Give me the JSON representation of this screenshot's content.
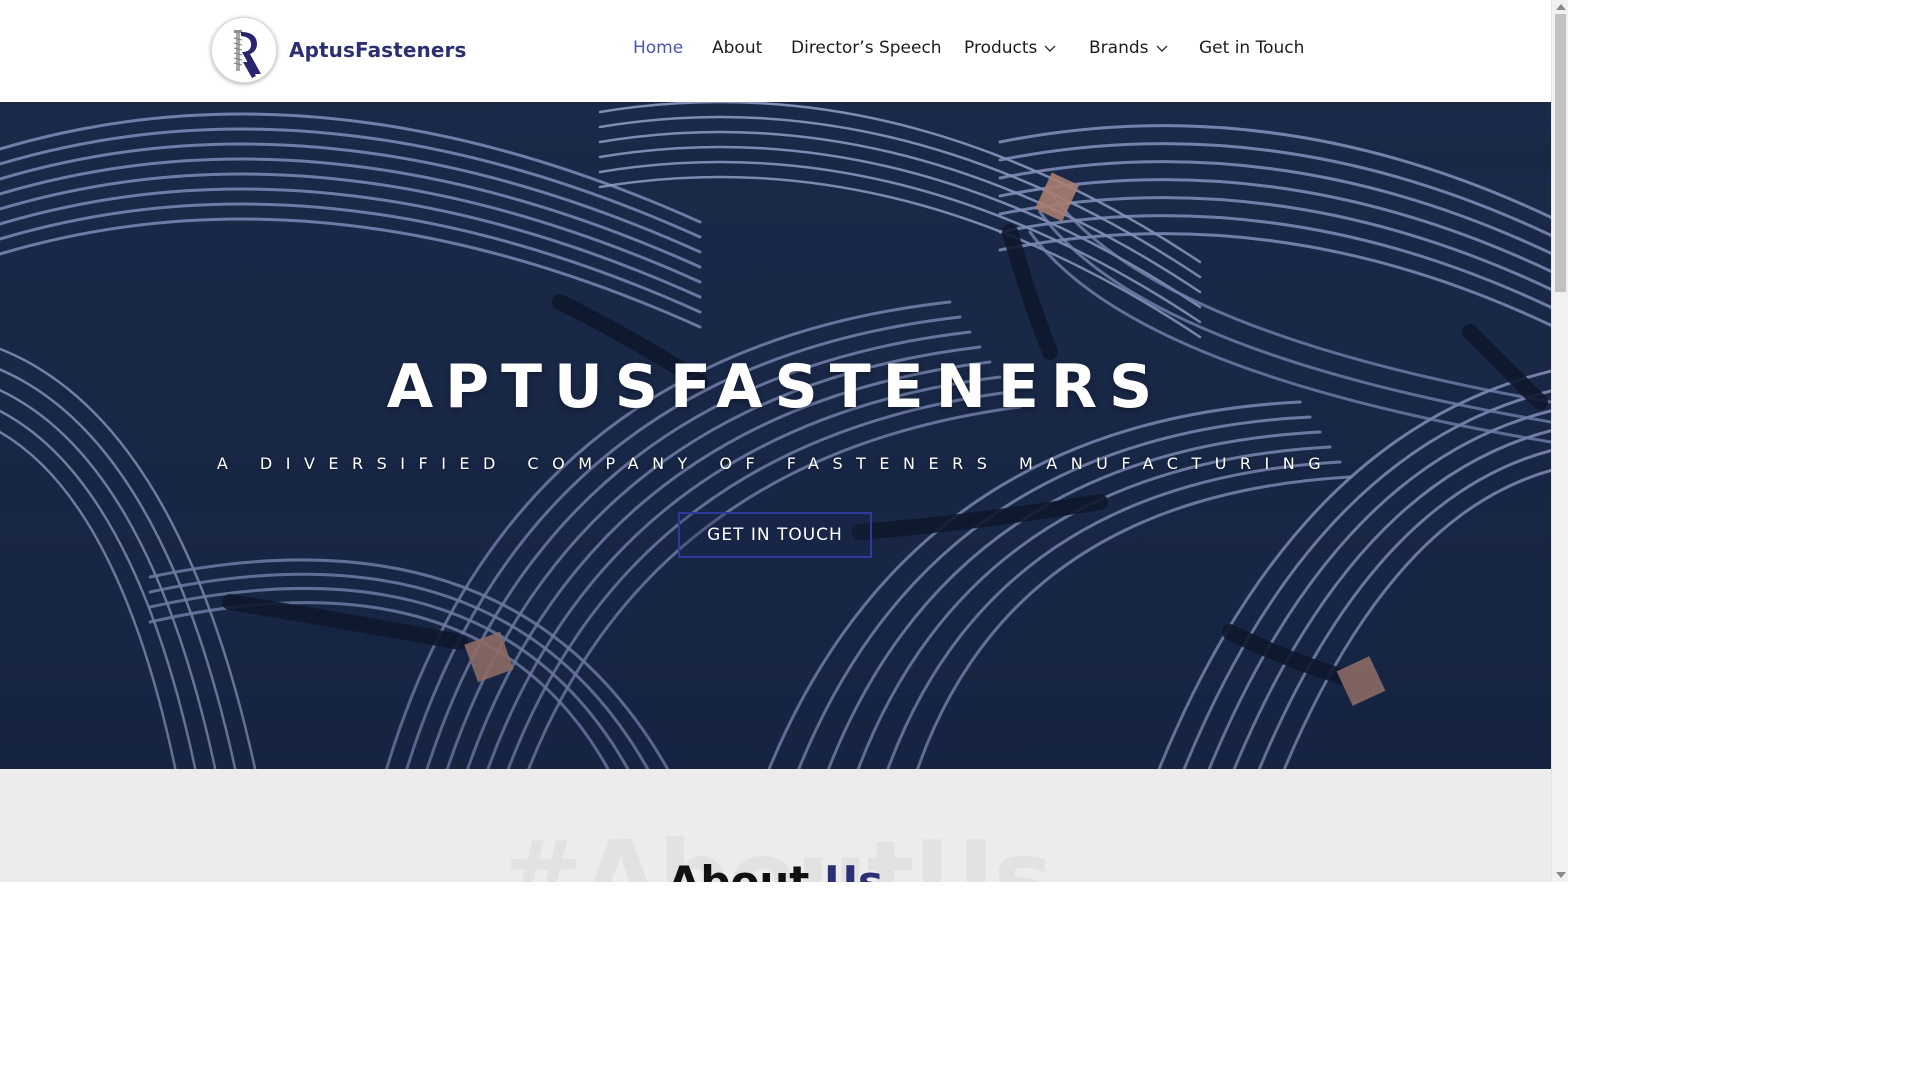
{
  "brand": {
    "name": "AptusFasteners",
    "logo_icon": "screw-r-logo-icon"
  },
  "nav": [
    {
      "label": "Home",
      "active": true,
      "dropdown": false
    },
    {
      "label": "About",
      "active": false,
      "dropdown": false
    },
    {
      "label": "Director’s Speech",
      "active": false,
      "dropdown": false
    },
    {
      "label": "Products",
      "active": false,
      "dropdown": true
    },
    {
      "label": "Brands",
      "active": false,
      "dropdown": true
    },
    {
      "label": "Get in Touch",
      "active": false,
      "dropdown": false
    }
  ],
  "hero": {
    "title": "APTUSFASTENERS",
    "subtitle": "A DIVERSIFIED COMPANY OF FASTENERS MANUFACTURING",
    "button": "GET IN TOUCH"
  },
  "about": {
    "ghost_text": "#AboutUs",
    "title_main": "About",
    "title_accent": "Us"
  },
  "colors": {
    "brand": "#2b2f73",
    "nav_active": "#4b55b0",
    "button_border": "#2e3a9b"
  }
}
